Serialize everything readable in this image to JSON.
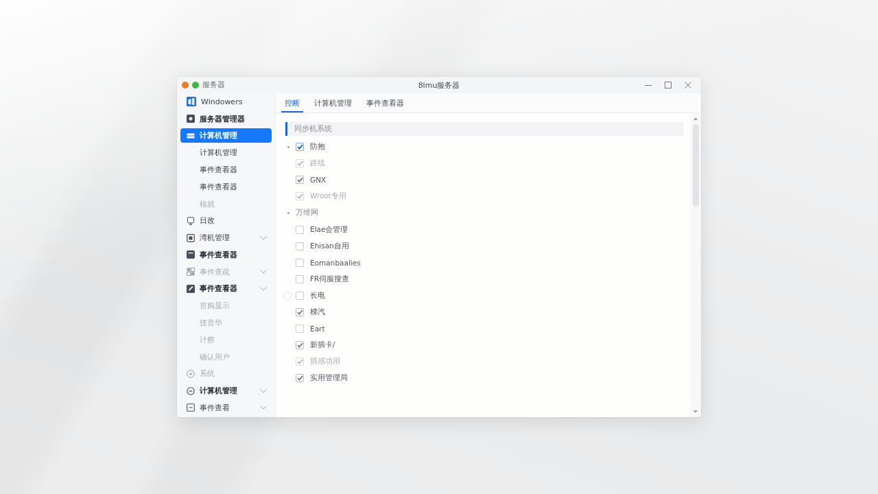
{
  "window": {
    "app_name": "服务器",
    "title": "8lmu服务器",
    "traffic_lights": [
      {
        "color": "#f07c22"
      },
      {
        "color": "#3cb93c"
      }
    ]
  },
  "sidebar": {
    "items": [
      {
        "label": "Windowers",
        "selected": false,
        "bold": false,
        "disabled": false,
        "chevron": false
      },
      {
        "label": "服务器管理器",
        "selected": false,
        "bold": true,
        "disabled": false,
        "chevron": false
      },
      {
        "label": "计算机管理",
        "selected": true,
        "bold": true,
        "disabled": false,
        "chevron": false,
        "children": [
          {
            "label": "计算机管理",
            "selected": false,
            "disabled": false
          },
          {
            "label": "事件查看器",
            "selected": false,
            "disabled": false
          },
          {
            "label": "事件查看器",
            "selected": false,
            "disabled": false
          },
          {
            "label": "核就",
            "selected": false,
            "disabled": true
          }
        ]
      },
      {
        "label": "日改",
        "selected": false,
        "bold": false,
        "disabled": false,
        "chevron": false
      },
      {
        "label": "湾机管理",
        "selected": false,
        "bold": false,
        "disabled": false,
        "chevron": true
      },
      {
        "label": "事件查看器",
        "selected": false,
        "bold": true,
        "disabled": false,
        "chevron": false
      },
      {
        "label": "事件查疏",
        "selected": false,
        "bold": false,
        "disabled": true,
        "chevron": true
      },
      {
        "label": "事件查看器",
        "selected": false,
        "bold": true,
        "disabled": false,
        "chevron": true,
        "children": [
          {
            "label": "首购显示",
            "selected": false,
            "disabled": true
          },
          {
            "label": "技音华",
            "selected": false,
            "disabled": true
          },
          {
            "label": "计察",
            "selected": false,
            "disabled": true
          },
          {
            "label": "确认用户",
            "selected": false,
            "disabled": true
          }
        ]
      },
      {
        "label": "系统",
        "selected": false,
        "bold": false,
        "disabled": true,
        "chevron": false
      },
      {
        "label": "计算机管理",
        "selected": false,
        "bold": true,
        "disabled": false,
        "chevron": true
      },
      {
        "label": "事件查看",
        "selected": false,
        "bold": false,
        "disabled": false,
        "chevron": true
      }
    ]
  },
  "tabs": [
    {
      "label": "控断",
      "selected": true
    },
    {
      "label": "计算机管理",
      "selected": false
    },
    {
      "label": "事件查看器",
      "selected": false
    }
  ],
  "content": {
    "section": "同步机系统",
    "rows": [
      {
        "kind": "option",
        "label": "防抱",
        "checked": true,
        "color": "#1a66d9",
        "disabled": false,
        "bullet": true,
        "ring": false
      },
      {
        "kind": "option",
        "label": "路线",
        "checked": true,
        "color": "#b9bdc4",
        "disabled": true,
        "bullet": false,
        "ring": false
      },
      {
        "kind": "option",
        "label": "GNX",
        "checked": true,
        "color": "#7d828a",
        "disabled": false,
        "bullet": false,
        "ring": false
      },
      {
        "kind": "option",
        "label": "Wroot专用",
        "checked": true,
        "color": "#b9bdc4",
        "disabled": true,
        "bullet": false,
        "ring": false
      },
      {
        "kind": "group",
        "label": "万维网"
      },
      {
        "kind": "option",
        "label": "Elae会管理",
        "checked": false,
        "disabled": false,
        "bullet": false,
        "ring": false
      },
      {
        "kind": "option",
        "label": "Ehisan自用",
        "checked": false,
        "disabled": false,
        "bullet": false,
        "ring": false
      },
      {
        "kind": "option",
        "label": "Eomanbaalies",
        "checked": false,
        "disabled": false,
        "bullet": false,
        "ring": false
      },
      {
        "kind": "option",
        "label": "FR伺服搜查",
        "checked": false,
        "disabled": false,
        "bullet": false,
        "ring": false
      },
      {
        "kind": "option",
        "label": "长电",
        "checked": false,
        "disabled": false,
        "bullet": false,
        "ring": true
      },
      {
        "kind": "option",
        "label": "梯汽",
        "checked": true,
        "color": "#7d828a",
        "disabled": false,
        "bullet": false,
        "ring": false
      },
      {
        "kind": "option",
        "label": "Eart",
        "checked": false,
        "disabled": false,
        "bullet": false,
        "ring": false
      },
      {
        "kind": "option",
        "label": "新插卡/",
        "checked": true,
        "color": "#7d828a",
        "disabled": false,
        "bullet": false,
        "ring": false
      },
      {
        "kind": "option",
        "label": "插感功用",
        "checked": true,
        "color": "#b9bdc4",
        "disabled": true,
        "bullet": false,
        "ring": false
      },
      {
        "kind": "option",
        "label": "实用管理局",
        "checked": true,
        "color": "#7d828a",
        "disabled": false,
        "bullet": false,
        "ring": false
      }
    ]
  }
}
